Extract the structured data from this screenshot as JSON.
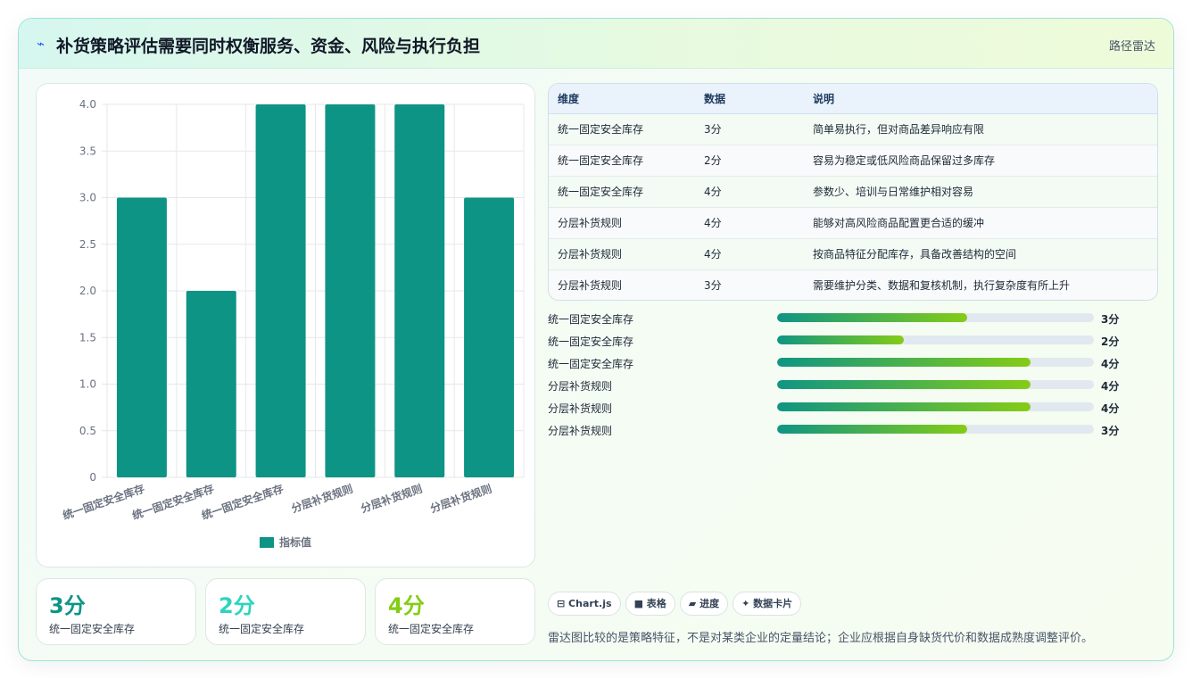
{
  "header": {
    "icon": "lightning-icon",
    "title": "补货策略评估需要同时权衡服务、资金、风险与执行负担",
    "tag": "路径雷达"
  },
  "chart_data": {
    "type": "bar",
    "categories": [
      "统一固定安全库存",
      "统一固定安全库存",
      "统一固定安全库存",
      "分层补货规则",
      "分层补货规则",
      "分层补货规则"
    ],
    "series": [
      {
        "name": "指标值",
        "values": [
          3,
          2,
          4,
          4,
          4,
          3
        ]
      }
    ],
    "ylim": [
      0,
      4
    ],
    "yticks": [
      "0",
      "0.5",
      "1.0",
      "1.5",
      "2.0",
      "2.5",
      "3.0",
      "3.5",
      "4.0"
    ],
    "grid": true,
    "legend_placement": "bottom",
    "color": "#0e9484"
  },
  "stats": [
    {
      "value": "3分",
      "label": "统一固定安全库存",
      "color": "#0d9488"
    },
    {
      "value": "2分",
      "label": "统一固定安全库存",
      "color": "#2dd4bf"
    },
    {
      "value": "4分",
      "label": "统一固定安全库存",
      "color": "#84cc16"
    }
  ],
  "table": {
    "headers": [
      "维度",
      "数据",
      "说明"
    ],
    "rows": [
      [
        "统一固定安全库存",
        "3分",
        "简单易执行，但对商品差异响应有限"
      ],
      [
        "统一固定安全库存",
        "2分",
        "容易为稳定或低风险商品保留过多库存"
      ],
      [
        "统一固定安全库存",
        "4分",
        "参数少、培训与日常维护相对容易"
      ],
      [
        "分层补货规则",
        "4分",
        "能够对高风险商品配置更合适的缓冲"
      ],
      [
        "分层补货规则",
        "4分",
        "按商品特征分配库存，具备改善结构的空间"
      ],
      [
        "分层补货规则",
        "3分",
        "需要维护分类、数据和复核机制，执行复杂度有所上升"
      ]
    ]
  },
  "progress": {
    "max": 5,
    "items": [
      {
        "label": "统一固定安全库存",
        "value": 3,
        "text": "3分"
      },
      {
        "label": "统一固定安全库存",
        "value": 2,
        "text": "2分"
      },
      {
        "label": "统一固定安全库存",
        "value": 4,
        "text": "4分"
      },
      {
        "label": "分层补货规则",
        "value": 4,
        "text": "4分"
      },
      {
        "label": "分层补货规则",
        "value": 4,
        "text": "4分"
      },
      {
        "label": "分层补货规则",
        "value": 3,
        "text": "3分"
      }
    ]
  },
  "chips": [
    {
      "icon": "chart-icon",
      "glyph": "⊟",
      "label": "Chart.js"
    },
    {
      "icon": "table-icon",
      "glyph": "■",
      "label": "表格"
    },
    {
      "icon": "progress-icon",
      "glyph": "▰",
      "label": "进度"
    },
    {
      "icon": "sparkle-icon",
      "glyph": "✦",
      "label": "数据卡片"
    }
  ],
  "note": "雷达图比较的是策略特征，不是对某类企业的定量结论；企业应根据自身缺货代价和数据成熟度调整评价。"
}
